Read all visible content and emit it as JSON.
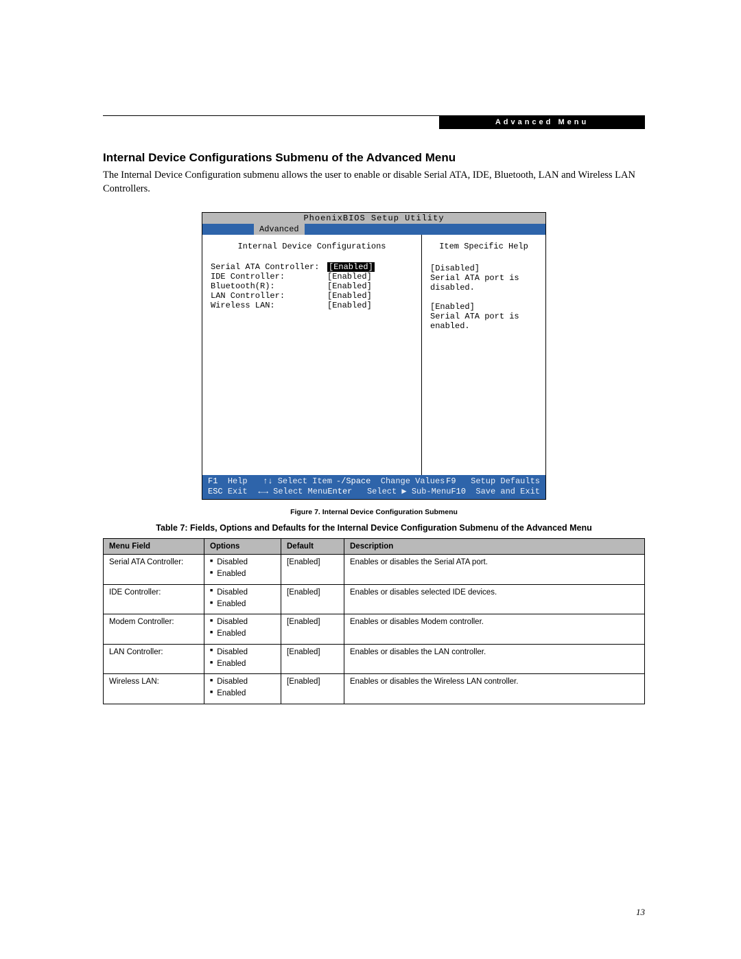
{
  "header": {
    "tab_label": "Advanced Menu"
  },
  "section": {
    "title": "Internal Device Configurations Submenu of the Advanced Menu",
    "intro": "The Internal Device Configuration submenu allows the user to enable or disable Serial ATA, IDE, Bluetooth, LAN and Wireless LAN Controllers."
  },
  "bios": {
    "utility_title": "PhoenixBIOS Setup Utility",
    "active_tab": "Advanced",
    "panel_title": "Internal Device Configurations",
    "help_title": "Item Specific Help",
    "items": [
      {
        "label": "Serial ATA Controller:",
        "value": "[Enabled]",
        "selected": true
      },
      {
        "label": "IDE Controller:",
        "value": "[Enabled]",
        "selected": false
      },
      {
        "label": "Bluetooth(R):",
        "value": "[Enabled]",
        "selected": false
      },
      {
        "label": "LAN Controller:",
        "value": "[Enabled]",
        "selected": false
      },
      {
        "label": "Wireless LAN:",
        "value": "[Enabled]",
        "selected": false
      }
    ],
    "help_lines": [
      "[Disabled]",
      "Serial ATA port is",
      "disabled.",
      "",
      "[Enabled]",
      "Serial ATA port is",
      "enabled."
    ],
    "footer": {
      "r1c1_key": "F1",
      "r1c1_txt": "Help",
      "r1c2_key": "↑↓",
      "r1c2_txt": "Select Item",
      "r1c3_key": "-/Space",
      "r1c3_txt": "Change Values",
      "r1c4_key": "F9",
      "r1c4_txt": "Setup Defaults",
      "r2c1_key": "ESC",
      "r2c1_txt": "Exit",
      "r2c2_key": "←→",
      "r2c2_txt": "Select Menu",
      "r2c3_key": "Enter",
      "r2c3_txt": "Select ▶ Sub-Menu",
      "r2c4_key": "F10",
      "r2c4_txt": "Save and Exit"
    }
  },
  "figure_caption": "Figure 7.  Internal Device Configuration Submenu",
  "table_caption": "Table 7: Fields, Options and Defaults for the Internal Device Configuration Submenu of the Advanced Menu",
  "table": {
    "headers": {
      "c1": "Menu Field",
      "c2": "Options",
      "c3": "Default",
      "c4": "Description"
    },
    "rows": [
      {
        "field": "Serial ATA Controller:",
        "opt1": "Disabled",
        "opt2": "Enabled",
        "def": "[Enabled]",
        "desc": "Enables or disables the Serial ATA port."
      },
      {
        "field": "IDE Controller:",
        "opt1": "Disabled",
        "opt2": "Enabled",
        "def": "[Enabled]",
        "desc": "Enables or disables selected IDE devices."
      },
      {
        "field": "Modem Controller:",
        "opt1": "Disabled",
        "opt2": "Enabled",
        "def": "[Enabled]",
        "desc": "Enables or disables Modem controller."
      },
      {
        "field": "LAN Controller:",
        "opt1": "Disabled",
        "opt2": "Enabled",
        "def": "[Enabled]",
        "desc": "Enables or disables the LAN controller."
      },
      {
        "field": "Wireless LAN:",
        "opt1": "Disabled",
        "opt2": "Enabled",
        "def": "[Enabled]",
        "desc": "Enables or disables the Wireless LAN controller."
      }
    ]
  },
  "page_number": "13"
}
